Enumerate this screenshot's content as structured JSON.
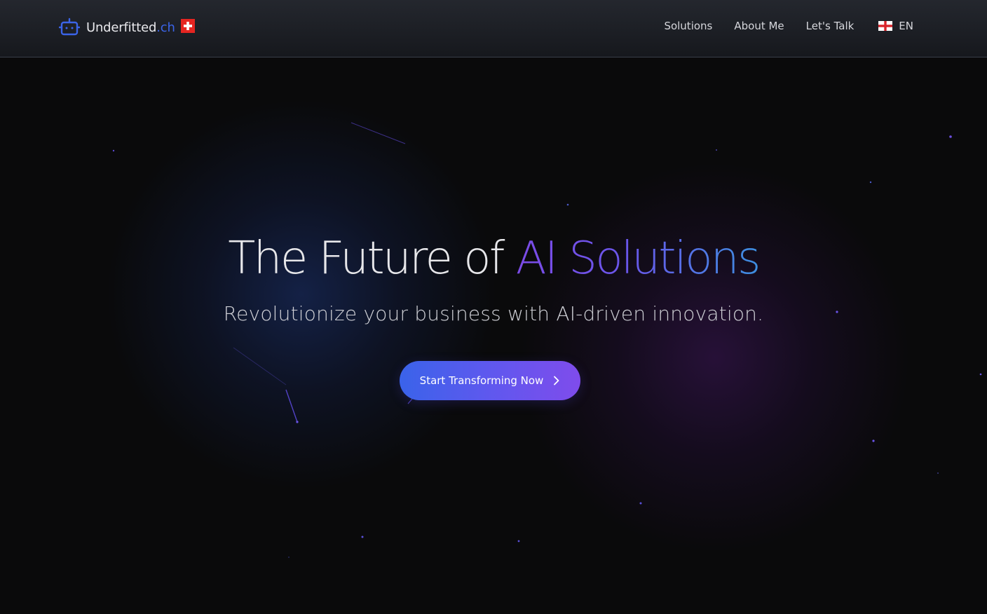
{
  "header": {
    "logo": {
      "name": "Underfitted",
      "tld": ".ch",
      "icon": "robot-icon",
      "flag": "swiss-flag-icon"
    },
    "nav": [
      {
        "label": "Solutions"
      },
      {
        "label": "About Me"
      },
      {
        "label": "Let's Talk"
      }
    ],
    "language": {
      "label": "EN",
      "flag": "england-flag-icon"
    }
  },
  "hero": {
    "title_prefix": "The Future of",
    "title_accent": "AI Solutions",
    "subtitle": "Revolutionize your business with AI-driven innovation.",
    "cta_label": "Start Transforming Now",
    "cta_icon": "chevron-right-icon"
  },
  "colors": {
    "background": "#0a0a0b",
    "accent_blue": "#3a63ea",
    "accent_purple": "#7f4cec",
    "tld_blue": "#3b64e8"
  }
}
